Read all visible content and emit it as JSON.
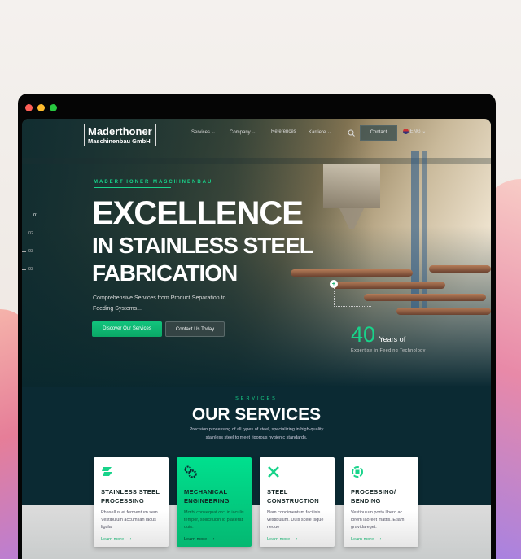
{
  "nav": {
    "logo_line1": "Maderthoner",
    "logo_line2": "Maschinenbau GmbH",
    "items": [
      "Services",
      "Company",
      "References",
      "Karriere"
    ],
    "contact": "Contact",
    "language": "ENG"
  },
  "hero": {
    "eyebrow": "MADERTHONER MASCHINENBAU",
    "title_line1": "EXCELLENCE",
    "title_line2": "IN STAINLESS STEEL",
    "title_line3": "FABRICATION",
    "subtitle": "Comprehensive Services from Product Separation to Feeding Systems...",
    "primary_button": "Discover Our Services",
    "secondary_button": "Contact Us Today",
    "slides": [
      "01",
      "02",
      "03",
      "03"
    ],
    "active_slide": 0,
    "stat_number": "40",
    "stat_unit": "Years of",
    "stat_caption": "Expertise in Feeding Technology"
  },
  "services": {
    "eyebrow": "SERVICES",
    "title": "OUR SERVICES",
    "description": "Precision processing of all types of steel, specializing in high-quality stainless steel to meet rigorous hygienic standards.",
    "cards": [
      {
        "title": "STAINLESS STEEL PROCESSING",
        "text": "Phasellus et fermentum sem. Vestibulum accumsan lacus ligula.",
        "link": "Learn more",
        "icon": "steel-beams-icon"
      },
      {
        "title": "MECHANICAL ENGINEERING",
        "text": "Morbi consequat orci in iaculis tempor, sollicitudin id placerat quis.",
        "link": "Learn more",
        "icon": "gears-icon"
      },
      {
        "title": "STEEL CONSTRUCTION",
        "text": "Nam condimentum facilisis vestibulum. Duis scele isque neque",
        "link": "Learn more",
        "icon": "wrench-screwdriver-icon"
      },
      {
        "title": "PROCESSING/ BENDING",
        "text": "Vestibulum porta libero ac lorem laoreet mattis. Etiam gravida eget.",
        "link": "Learn more",
        "icon": "recycle-process-icon"
      }
    ]
  },
  "colors": {
    "accent": "#18d38a",
    "dark": "#0b2a33"
  }
}
